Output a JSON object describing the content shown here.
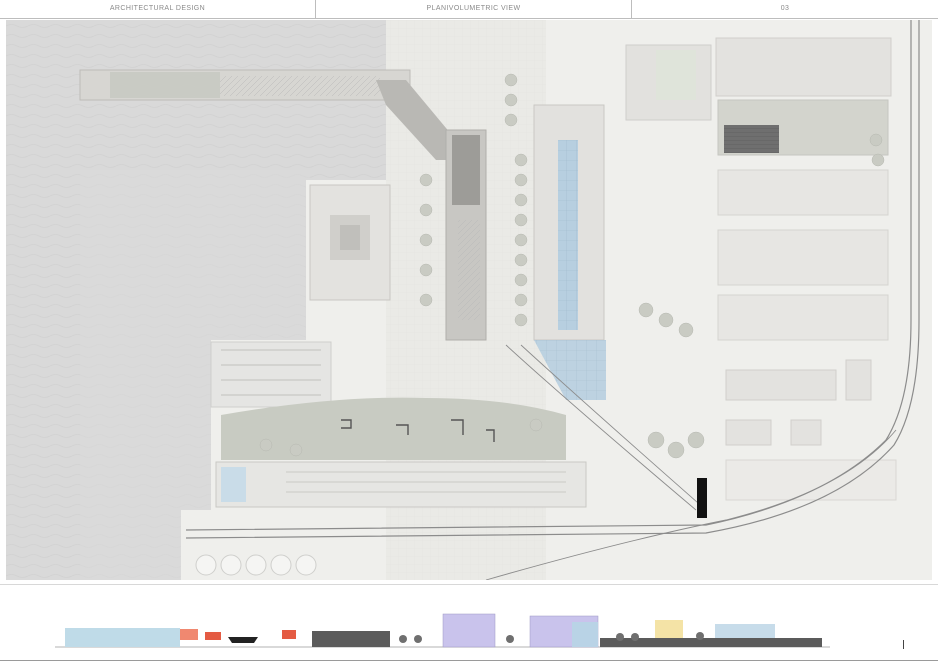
{
  "header": {
    "left_title": "ARCHITECTURAL DESIGN",
    "center_title": "PLANIVOLUMETRIC VIEW",
    "page_number": "03"
  },
  "section_strip": {
    "labels": [
      "",
      "",
      "",
      "",
      "",
      "",
      "",
      "",
      "",
      "",
      "",
      ""
    ]
  },
  "colors": {
    "water": "#d9d9d9",
    "paving": "#e9e8e4",
    "building": "#e2e1de",
    "roof_dark": "#7c7c7c",
    "glass_roof": "#a9c7dc",
    "greenery": "#b9bcb2",
    "tree": "#c9cbc3",
    "rail": "#8c8c8c",
    "section_ground": "#5b5b5b",
    "section_pink": "#f08870",
    "section_red": "#e45b43",
    "section_blue": "#b9d3e6",
    "section_purple": "#c9c3ec",
    "section_yellow": "#f4e3a6"
  },
  "icons": {
    "scale_bar": "scale-bar-icon"
  }
}
